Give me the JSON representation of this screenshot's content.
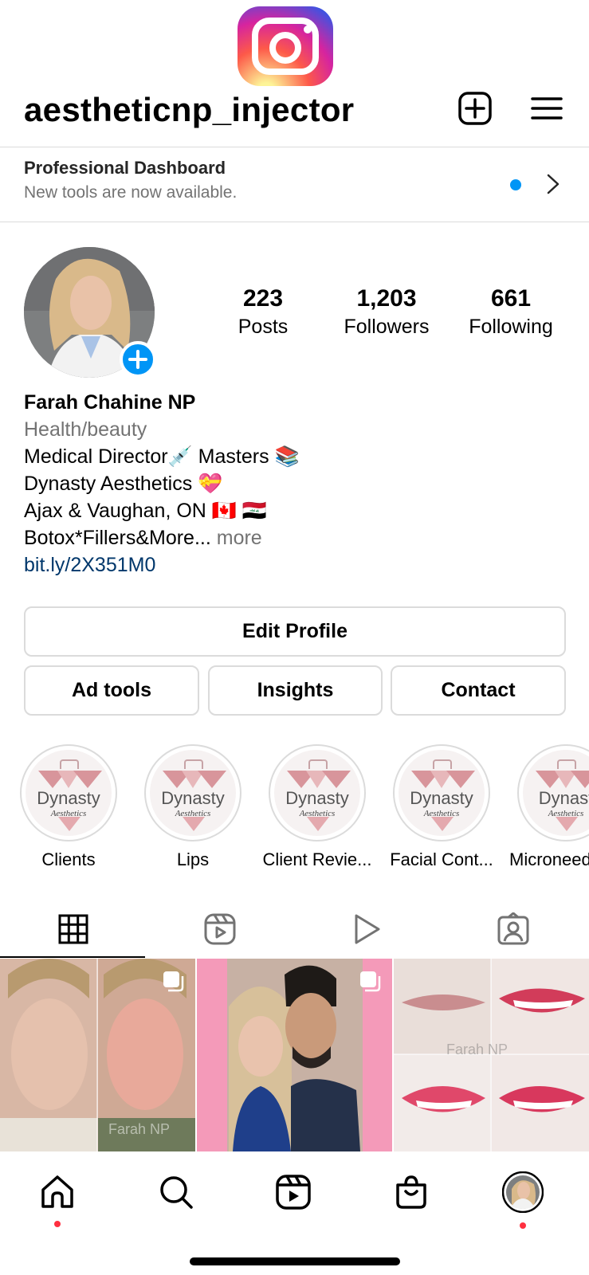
{
  "header": {
    "username": "aestheticnp_injector"
  },
  "dashboard": {
    "title": "Professional Dashboard",
    "subtitle": "New tools are now available."
  },
  "stats": {
    "posts_count": "223",
    "posts_label": "Posts",
    "followers_count": "1,203",
    "followers_label": "Followers",
    "following_count": "661",
    "following_label": "Following"
  },
  "bio": {
    "name": "Farah Chahine NP",
    "category": "Health/beauty",
    "line1": "Medical Director💉 Masters 📚",
    "line2": "Dynasty Aesthetics 💝",
    "line3": "Ajax & Vaughan, ON 🇨🇦 🇮🇶",
    "line4": "Botox*Fillers&More...",
    "more": "more",
    "link": "bit.ly/2X351M0"
  },
  "buttons": {
    "edit_profile": "Edit Profile",
    "ad_tools": "Ad tools",
    "insights": "Insights",
    "contact": "Contact"
  },
  "highlights": [
    {
      "label": "Clients",
      "brand": "Dynasty",
      "script": "Aesthetics"
    },
    {
      "label": "Lips",
      "brand": "Dynasty",
      "script": "Aesthetics"
    },
    {
      "label": "Client Revie...",
      "brand": "Dynasty",
      "script": "Aesthetics"
    },
    {
      "label": "Facial Cont...",
      "brand": "Dynasty",
      "script": "Aesthetics"
    },
    {
      "label": "Microneed",
      "brand": "Dynast",
      "script": "Aesthetics"
    }
  ],
  "grid": {
    "watermark1": "Farah NP",
    "watermark3": "Farah NP"
  },
  "colors": {
    "accent_blue": "#0095f6",
    "link_blue": "#00376b",
    "notification_red": "#ff3040",
    "border": "#dbdbdb"
  },
  "icons": [
    "instagram-logo",
    "plus-square-icon",
    "menu-icon",
    "chevron-right-icon",
    "plus-icon",
    "grid-icon",
    "reels-icon",
    "play-icon",
    "tagged-icon",
    "multi-post-icon",
    "home-icon",
    "search-icon",
    "shop-icon",
    "avatar"
  ]
}
